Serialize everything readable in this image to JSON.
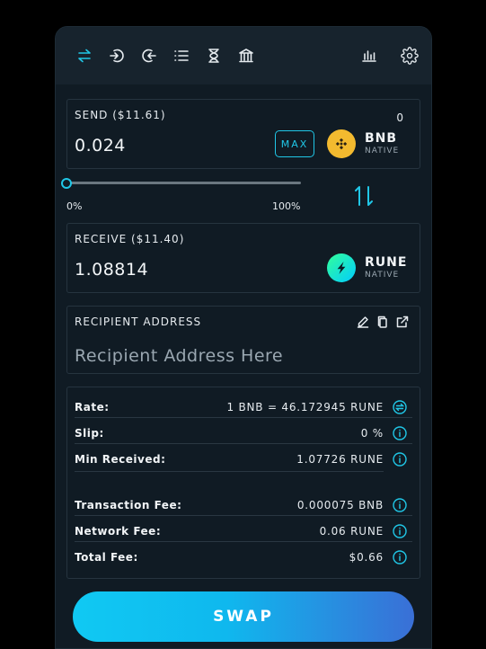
{
  "toolbar": {
    "items": [
      {
        "icon": "swap-arrows-icon",
        "active": true
      },
      {
        "icon": "add-liquidity-icon",
        "active": false
      },
      {
        "icon": "withdraw-icon",
        "active": false
      },
      {
        "icon": "list-icon",
        "active": false
      },
      {
        "icon": "hourglass-icon",
        "active": false
      },
      {
        "icon": "bank-icon",
        "active": false
      }
    ],
    "right_items": [
      {
        "icon": "chart-icon"
      },
      {
        "icon": "gear-icon"
      }
    ]
  },
  "send": {
    "label": "SEND ($11.61)",
    "amount": "0.024",
    "max_label": "MAX",
    "balance": "0",
    "asset": {
      "name": "BNB",
      "sub": "NATIVE",
      "color": "#f3ba2f"
    }
  },
  "slider": {
    "min_label": "0%",
    "max_label": "100%",
    "value_percent": 0
  },
  "receive": {
    "label": "RECEIVE ($11.40)",
    "amount": "1.08814",
    "asset": {
      "name": "RUNE",
      "sub": "NATIVE",
      "color": "#23dcc8"
    }
  },
  "recipient": {
    "label": "RECIPIENT ADDRESS",
    "placeholder": "Recipient Address Here"
  },
  "details": {
    "rate": {
      "label": "Rate:",
      "value": "1 BNB = 46.172945 RUNE"
    },
    "slip": {
      "label": "Slip:",
      "value": "0 %"
    },
    "min_received": {
      "label": "Min Received:",
      "value": "1.07726 RUNE"
    },
    "transaction_fee": {
      "label": "Transaction Fee:",
      "value": "0.000075 BNB"
    },
    "network_fee": {
      "label": "Network Fee:",
      "value": "0.06 RUNE"
    },
    "total_fee": {
      "label": "Total Fee:",
      "value": "$0.66"
    }
  },
  "swap_button": {
    "label": "SWAP"
  },
  "colors": {
    "accent": "#20c7e7",
    "panel": "#101b24",
    "toolbar": "#17232d"
  }
}
